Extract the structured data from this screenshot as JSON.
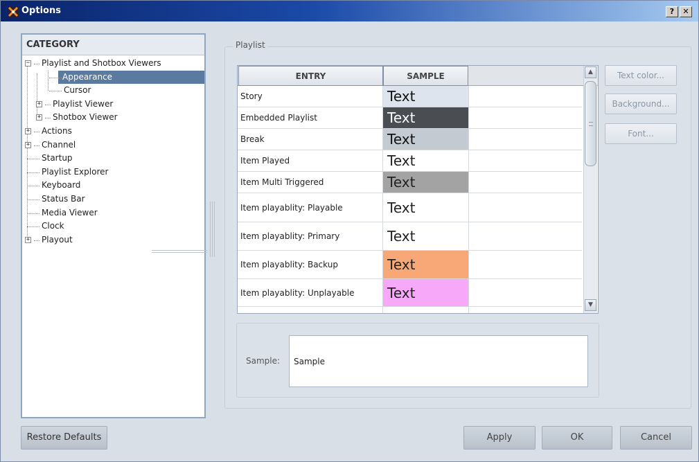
{
  "window": {
    "title": "Options",
    "help_label": "?",
    "close_label": "✕"
  },
  "category": {
    "header": "CATEGORY",
    "items": [
      {
        "label": "Playlist and Shotbox Viewers",
        "expander": "−"
      },
      {
        "label": "Appearance",
        "selected": true
      },
      {
        "label": "Cursor"
      },
      {
        "label": "Playlist Viewer",
        "expander": "+"
      },
      {
        "label": "Shotbox Viewer",
        "expander": "+"
      },
      {
        "label": "Actions",
        "expander": "+"
      },
      {
        "label": "Channel",
        "expander": "+"
      },
      {
        "label": "Startup"
      },
      {
        "label": "Playlist Explorer"
      },
      {
        "label": "Keyboard"
      },
      {
        "label": "Status Bar"
      },
      {
        "label": "Media Viewer"
      },
      {
        "label": "Clock"
      },
      {
        "label": "Playout",
        "expander": "+"
      }
    ]
  },
  "playlist": {
    "group_label": "Playlist",
    "columns": [
      "ENTRY",
      "SAMPLE"
    ],
    "rows": [
      {
        "entry": "Story",
        "sample": "Text",
        "bg": "#dde4ee",
        "fg": "#111111"
      },
      {
        "entry": "Embedded Playlist",
        "sample": "Text",
        "bg": "#4a4d52",
        "fg": "#ffffff"
      },
      {
        "entry": "Break",
        "sample": "Text",
        "bg": "#c4cad2",
        "fg": "#111111"
      },
      {
        "entry": "Item Played",
        "sample": "Text",
        "bg": "#ffffff",
        "fg": "#222222"
      },
      {
        "entry": "Item Multi Triggered",
        "sample": "Text",
        "bg": "#a3a3a3",
        "fg": "#222222"
      },
      {
        "entry": "Item playablity: Playable",
        "sample": "Text",
        "bg": "#ffffff",
        "fg": "#222222"
      },
      {
        "entry": "Item playablity: Primary",
        "sample": "Text",
        "bg": "#ffffff",
        "fg": "#222222"
      },
      {
        "entry": "Item playablity: Backup",
        "sample": "Text",
        "bg": "#f7a876",
        "fg": "#222222"
      },
      {
        "entry": "Item playablity: Unplayable",
        "sample": "Text",
        "bg": "#f8a8f8",
        "fg": "#222222"
      }
    ],
    "side_buttons": {
      "text_color": "Text color...",
      "background": "Background...",
      "font": "Font..."
    },
    "sample_label": "Sample:",
    "sample_value": "Sample"
  },
  "buttons": {
    "restore": "Restore Defaults",
    "apply": "Apply",
    "ok": "OK",
    "cancel": "Cancel"
  }
}
